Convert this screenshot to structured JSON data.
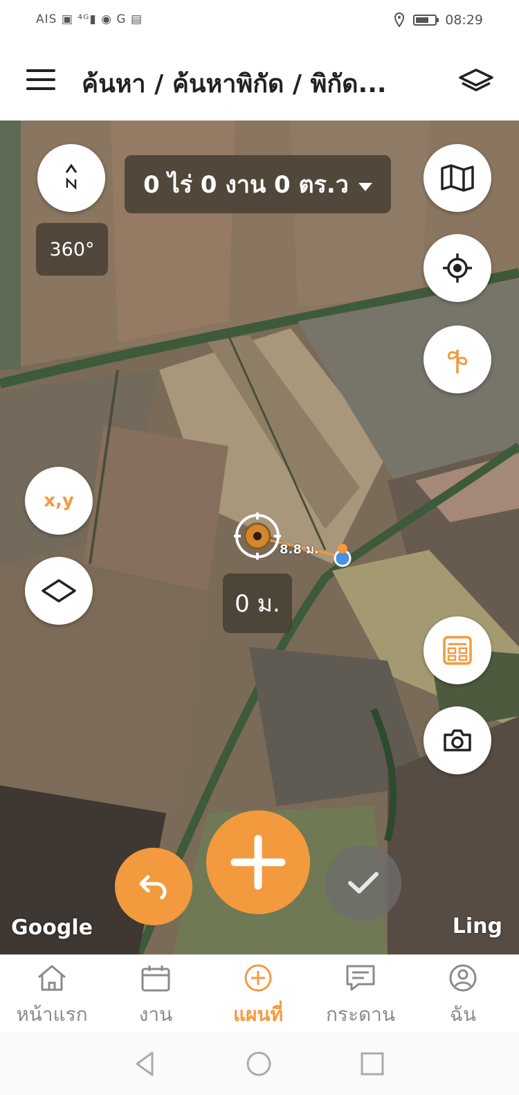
{
  "status_bar": {
    "left": "AIS ▣ ⁴ᴳ▮ ◉ G ▤",
    "time": "08:29"
  },
  "header": {
    "title": "ค้นหา / ค้นหาพิกัด / พิกัด..."
  },
  "map": {
    "area_label": "0 ไร่ 0 งาน 0 ตร.ว",
    "rotation_label": "360°",
    "distance_label": "0 ม.",
    "measure_label": "8.8 ม.",
    "xy_label": "x,y",
    "attribution_left": "Google",
    "attribution_right": "Ling"
  },
  "colors": {
    "accent": "#f39a3e",
    "inactive": "#8a8a8a"
  },
  "bottom_nav": {
    "items": [
      {
        "label": "หน้าแรก",
        "icon": "home-icon"
      },
      {
        "label": "งาน",
        "icon": "calendar-icon"
      },
      {
        "label": "แผนที่",
        "icon": "add-circle-icon"
      },
      {
        "label": "กระดาน",
        "icon": "board-icon"
      },
      {
        "label": "ฉัน",
        "icon": "user-icon"
      }
    ],
    "active": "แผนที่"
  }
}
